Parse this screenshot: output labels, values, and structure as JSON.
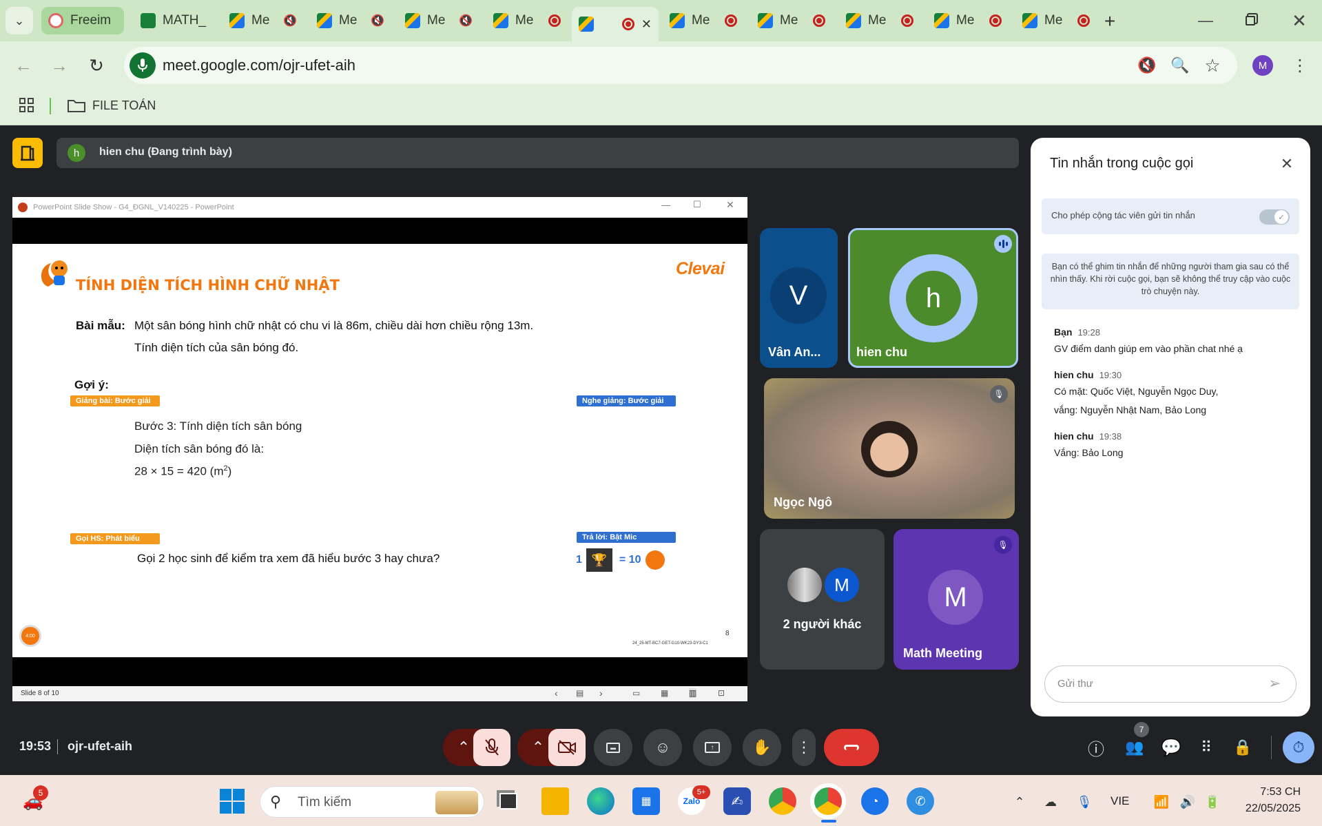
{
  "browser": {
    "tabs": [
      {
        "label": "Freeim",
        "type": "freeimg"
      },
      {
        "label": "MATH_",
        "type": "sheets"
      },
      {
        "label": "Me",
        "type": "meet",
        "state": "mute"
      },
      {
        "label": "Me",
        "type": "meet",
        "state": "mute"
      },
      {
        "label": "Me",
        "type": "meet",
        "state": "mute"
      },
      {
        "label": "Me",
        "type": "meet",
        "state": "rec"
      },
      {
        "label": "",
        "type": "meet",
        "state": "rec",
        "active": true
      },
      {
        "label": "Me",
        "type": "meet",
        "state": "rec"
      },
      {
        "label": "Me",
        "type": "meet",
        "state": "rec"
      },
      {
        "label": "Me",
        "type": "meet",
        "state": "rec"
      },
      {
        "label": "Me",
        "type": "meet",
        "state": "rec"
      },
      {
        "label": "Me",
        "type": "meet",
        "state": "rec"
      }
    ],
    "url": "meet.google.com/ojr-ufet-aih",
    "profile_initial": "M",
    "bookmark": "FILE TOÁN"
  },
  "meet": {
    "presenter_initial": "h",
    "presenter_label": "hien chu (Đang trình bày)",
    "time": "19:53",
    "code": "ojr-ufet-aih",
    "participants_count": "7"
  },
  "slide": {
    "window_title": "PowerPoint Slide Show  -  G4_ĐGNL_V140225 - PowerPoint",
    "title": "TÍNH DIỆN TÍCH HÌNH CHỮ NHẬT",
    "brand": "Clevai",
    "example_label": "Bài mẫu:",
    "example_line1": "Một sân bóng hình chữ nhật có chu vi là 86m, chiều dài hơn chiều rộng 13m.",
    "example_line2": "Tính diện tích của sân bóng đó.",
    "hint_label": "Gợi ý:",
    "tag_teach": "Giảng bài: Bước giải",
    "tag_listen": "Nghe giảng: Bước giải",
    "step": "Bước 3: Tính diện tích sân bóng",
    "area_line": "Diện tích sân bóng đó là:",
    "calc": "28 × 15 = 420 (m",
    "calc_sup": "2",
    "calc_end": ")",
    "tag_call": "Gọi HS: Phát biểu",
    "tag_answer": "Trả lời: Bật Mic",
    "question": "Gọi 2 học sinh để kiểm tra xem đã hiểu bước 3 hay chưa?",
    "reward_left": "1",
    "reward_right": "= 10",
    "page": "8",
    "code": "24_25-MT-BC7-GET-G10-WK23-DY3-C1",
    "timer": "4:00",
    "status": "Slide 8 of 10"
  },
  "tiles": [
    {
      "initial": "V",
      "name": "Vân An..."
    },
    {
      "initial": "h",
      "name": "hien chu"
    },
    {
      "name": "Ngọc Ngô"
    },
    {
      "initial": "M",
      "name": "2 người khác"
    },
    {
      "initial": "M",
      "name": "Math Meeting"
    }
  ],
  "chat": {
    "title": "Tin nhắn trong cuộc gọi",
    "toggle_label": "Cho phép cộng tác viên gửi tin nhắn",
    "info": "Bạn có thể ghim tin nhắn để những người tham gia sau có thể nhìn thấy. Khi rời cuộc gọi, bạn sẽ không thể truy cập vào cuộc trò chuyện này.",
    "messages": [
      {
        "sender": "Bạn",
        "time": "19:28",
        "lines": [
          "GV điểm danh giúp em vào phần chat nhé ạ"
        ]
      },
      {
        "sender": "hien chu",
        "time": "19:30",
        "lines": [
          "Có mặt: Quốc Việt, Nguyễn Ngọc Duy,",
          "vắng: Nguyễn Nhật Nam, Bảo Long"
        ]
      },
      {
        "sender": "hien chu",
        "time": "19:38",
        "lines": [
          "Vắng: Bảo Long"
        ]
      }
    ],
    "input_placeholder": "Gửi thư"
  },
  "taskbar": {
    "search": "Tìm kiếm",
    "notif_badge": "5",
    "zalo_badge": "5+",
    "lang": "VIE",
    "time": "7:53 CH",
    "date": "22/05/2025"
  }
}
